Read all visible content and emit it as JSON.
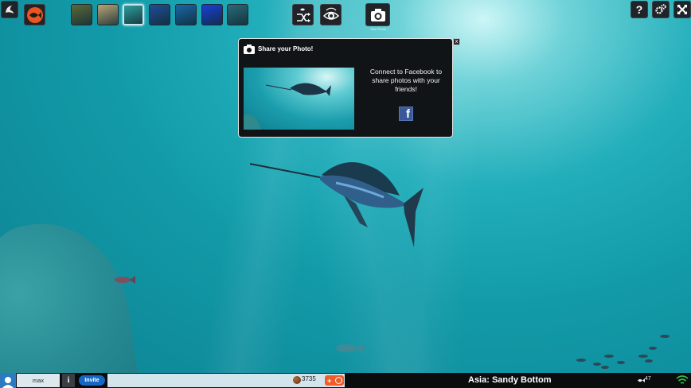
{
  "toolbar": {
    "left_buttons": [
      "menu-icon",
      "fish-species-icon"
    ],
    "scenes": [
      {
        "name": "scene-sunlight",
        "color": "#5a6a3a",
        "active": false
      },
      {
        "name": "scene-sandy-shallows",
        "color": "#b8a574",
        "active": false
      },
      {
        "name": "scene-sandy-bottom",
        "color": "#2e9d9a",
        "active": true
      },
      {
        "name": "scene-deep-blue",
        "color": "#1f4f95",
        "active": false
      },
      {
        "name": "scene-kelp",
        "color": "#1a66a6",
        "active": false
      },
      {
        "name": "scene-open-blue",
        "color": "#1a3fd6",
        "active": false
      },
      {
        "name": "scene-reef",
        "color": "#2a6a77",
        "active": false
      }
    ],
    "take_photo_label": "Take Photo",
    "right_buttons": [
      "help-icon",
      "settings-icon",
      "fullscreen-icon"
    ]
  },
  "dialog": {
    "title": "Share your Photo!",
    "message": "Connect to Facebook to share photos with your friends!",
    "close_label": "x",
    "facebook_label": "f"
  },
  "bottom_bar": {
    "username": "max",
    "info_label": "i",
    "invite_label": "Invite",
    "coins": "3735",
    "add_label": "+",
    "location": "Asia: Sandy Bottom",
    "fish_count": "47"
  }
}
